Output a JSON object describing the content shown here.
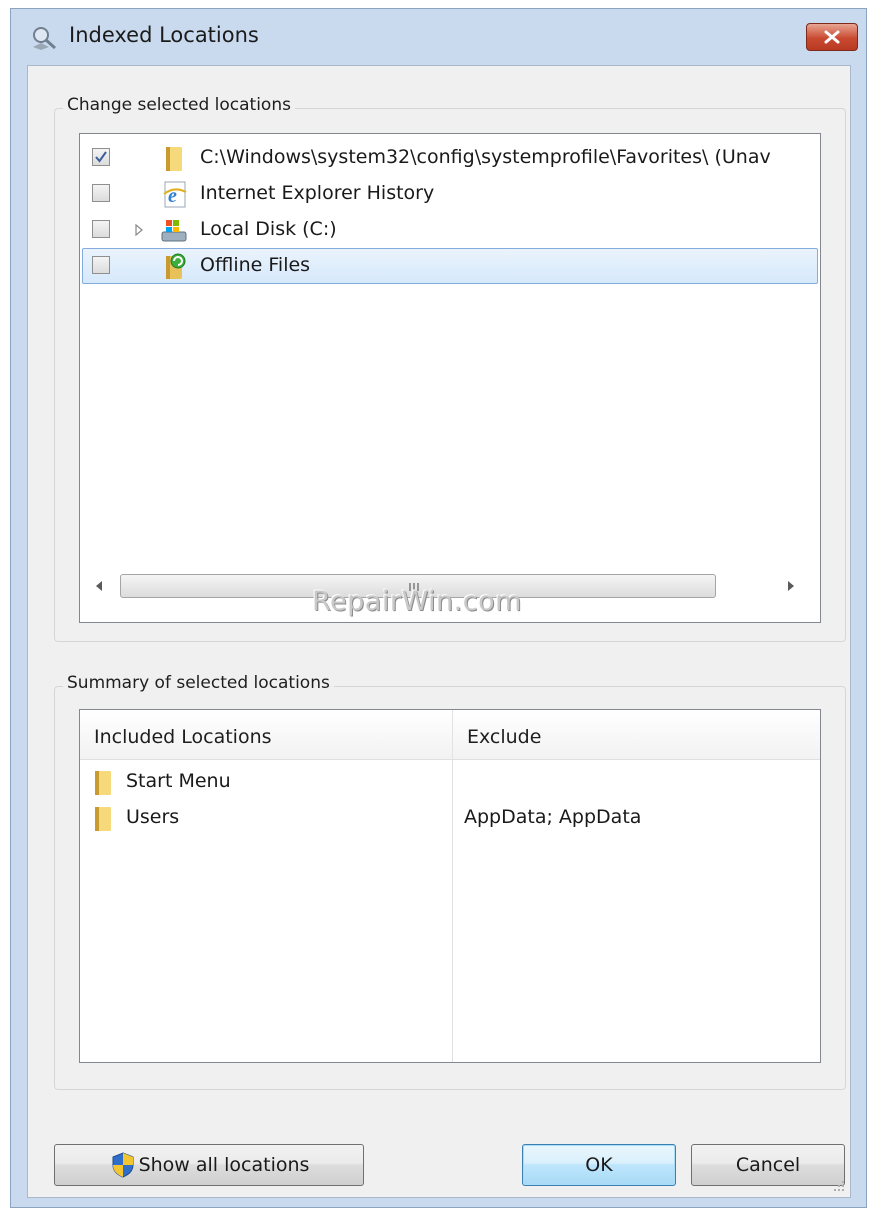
{
  "window": {
    "title": "Indexed Locations",
    "close_icon": "close-icon"
  },
  "change_group": {
    "title": "Change selected locations",
    "items": [
      {
        "label": "C:\\Windows\\system32\\config\\systemprofile\\Favorites\\ (Unav",
        "checked": true,
        "icon": "folder-icon",
        "expandable": false,
        "selected": false
      },
      {
        "label": "Internet Explorer History",
        "checked": false,
        "icon": "internet-explorer-icon",
        "expandable": false,
        "selected": false
      },
      {
        "label": "Local Disk (C:)",
        "checked": false,
        "icon": "local-disk-icon",
        "expandable": true,
        "selected": false
      },
      {
        "label": "Offline Files",
        "checked": false,
        "icon": "offline-files-icon",
        "expandable": false,
        "selected": true
      }
    ],
    "scroll_grip": "III"
  },
  "watermark": "RepairWin.com",
  "summary_group": {
    "title": "Summary of selected locations",
    "columns": [
      "Included Locations",
      "Exclude"
    ],
    "rows": [
      {
        "location": "Start Menu",
        "exclude": ""
      },
      {
        "location": "Users",
        "exclude": "AppData; AppData"
      }
    ]
  },
  "buttons": {
    "show_all": "Show all locations",
    "ok": "OK",
    "cancel": "Cancel"
  },
  "colors": {
    "accent": "#3c7fb1",
    "selection": "#d6e9fb",
    "close": "#c94a31"
  }
}
